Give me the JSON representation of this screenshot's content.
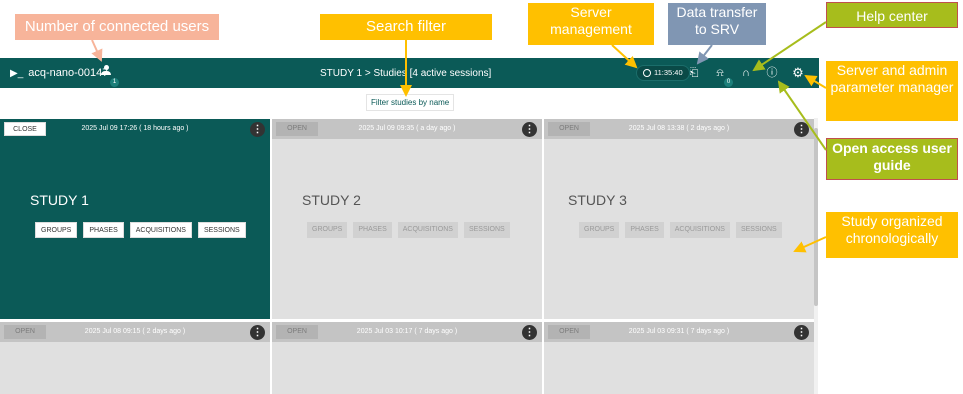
{
  "header": {
    "host": "acq-nano-00147",
    "user_count": "1",
    "breadcrumb": "STUDY 1 > Studies [4 active sessions]",
    "clock": "11:35:40",
    "transfer_count": "0"
  },
  "filter": {
    "label": "Filter studies by name"
  },
  "cards": [
    {
      "action": "CLOSE",
      "date": "2025 Jul 09 17:26 ( 18 hours ago )",
      "title": "STUDY 1",
      "buttons": [
        "GROUPS",
        "PHASES",
        "ACQUISITIONS",
        "SESSIONS"
      ]
    },
    {
      "action": "OPEN",
      "date": "2025 Jul 09 09:35 ( a day ago )",
      "title": "STUDY 2",
      "buttons": [
        "GROUPS",
        "PHASES",
        "ACQUISITIONS",
        "SESSIONS"
      ]
    },
    {
      "action": "OPEN",
      "date": "2025 Jul 08 13:38 ( 2 days ago )",
      "title": "STUDY 3",
      "buttons": [
        "GROUPS",
        "PHASES",
        "ACQUISITIONS",
        "SESSIONS"
      ]
    },
    {
      "action": "OPEN",
      "date": "2025 Jul 08 09:15 ( 2 days ago )"
    },
    {
      "action": "OPEN",
      "date": "2025 Jul 03 10:17 ( 7 days ago )"
    },
    {
      "action": "OPEN",
      "date": "2025 Jul 03 09:31 ( 7 days ago )"
    }
  ],
  "callouts": {
    "users": "Number of connected users",
    "search": "Search filter",
    "server": "Server management",
    "transfer": "Data transfer to SRV",
    "help": "Help center",
    "admin": "Server and admin parameter manager",
    "guide": "Open access user guide",
    "chrono": "Study organized chronologically"
  },
  "colors": {
    "primary": "#0b5a57",
    "callout_orange": "#ffc000",
    "callout_green": "#a7bd1c",
    "callout_blue": "#8096b3",
    "callout_salmon": "#f7b49a"
  }
}
